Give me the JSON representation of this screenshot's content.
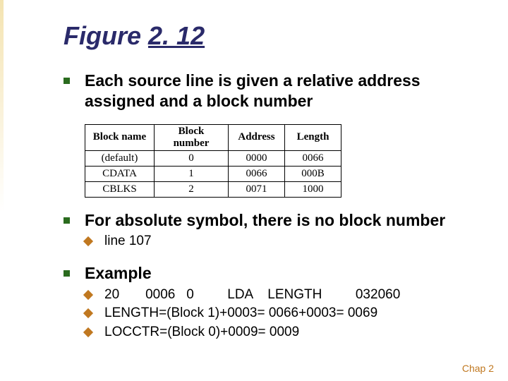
{
  "title_plain": "Figure ",
  "title_underlined": "2. 12",
  "bullets": [
    {
      "text": "Each source line is given a relative address assigned and a block number"
    },
    {
      "text": "For absolute symbol, there is no block number",
      "sub": [
        "line 107"
      ]
    },
    {
      "text": "Example",
      "sub": [
        "20       0006   0         LDA    LENGTH         032060",
        "LENGTH=(Block 1)+0003= 0066+0003= 0069",
        "LOCCTR=(Block 0)+0009= 0009"
      ]
    }
  ],
  "table": {
    "headers": [
      "Block name",
      "Block number",
      "Address",
      "Length"
    ],
    "rows": [
      [
        "(default)",
        "0",
        "0000",
        "0066"
      ],
      [
        "CDATA",
        "1",
        "0066",
        "000B"
      ],
      [
        "CBLKS",
        "2",
        "0071",
        "1000"
      ]
    ]
  },
  "footer": "Chap 2"
}
